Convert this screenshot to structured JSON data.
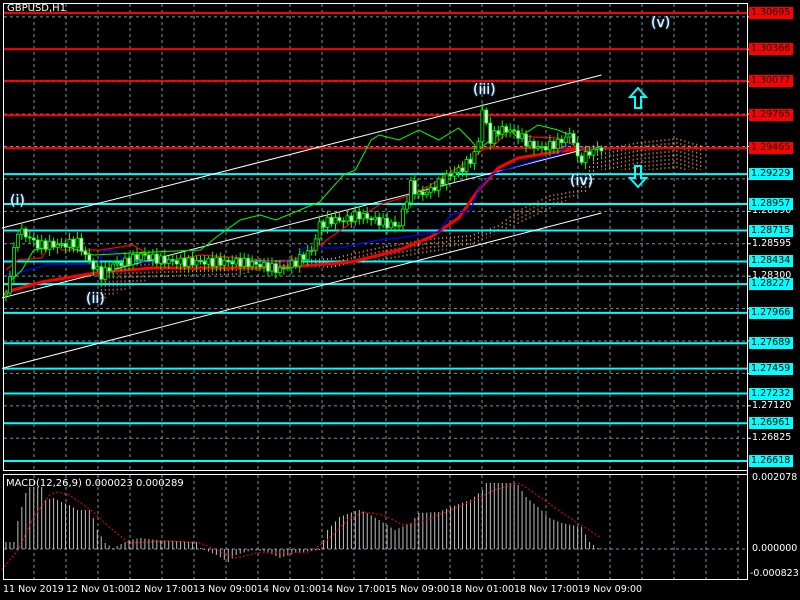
{
  "window": {
    "symbol_title": "GBPUSD,H1"
  },
  "colors": {
    "background": "#000000",
    "resistance": "#ff0000",
    "support": "#00ffff",
    "candle": "#00ff00",
    "tenkan": "#ff0000",
    "kijun": "#0000ff",
    "moving_average": "#ff0000",
    "chikou": "#00ff00",
    "cloud": "#ffa060",
    "channel": "#ffffff",
    "signal": "#ff0000",
    "histogram": "#c0c0c0"
  },
  "chart_data": [
    {
      "type": "line",
      "title": "GBPUSD,H1",
      "x_unit": "bar index (H1)",
      "ylim": [
        1.265,
        1.3082
      ],
      "grid": true,
      "y_ticks_visible": [
        "1.28890",
        "1.28595",
        "1.28300",
        "1.27120",
        "1.26825"
      ],
      "y_grid_step": 0.00295,
      "y_grid_base": 1.26825,
      "x_tick_labels": [
        "11 Nov 2019",
        "12 Nov 01:00",
        "12 Nov 17:00",
        "13 Nov 09:00",
        "14 Nov 01:00",
        "14 Nov 17:00",
        "15 Nov 09:00",
        "18 Nov 01:00",
        "18 Nov 17:00",
        "19 Nov 09:00"
      ],
      "resistance_levels": [
        "1.30695",
        "1.30366",
        "1.30077",
        "1.29765",
        "1.29465"
      ],
      "support_levels": [
        "1.29229",
        "1.28957",
        "1.28715",
        "1.28434",
        "1.28227",
        "1.27966",
        "1.27689",
        "1.27459",
        "1.27232",
        "1.26961",
        "1.26618"
      ],
      "closes": [
        [
          1,
          1.28129
        ],
        [
          4,
          1.2872
        ],
        [
          6,
          1.28675
        ],
        [
          9,
          1.28584
        ],
        [
          11,
          1.28584
        ],
        [
          15,
          1.28584
        ],
        [
          19,
          1.28611
        ],
        [
          22,
          1.28429
        ],
        [
          25,
          1.28311
        ],
        [
          28,
          1.28402
        ],
        [
          31,
          1.28429
        ],
        [
          35,
          1.28493
        ],
        [
          40,
          1.28447
        ],
        [
          45,
          1.28429
        ],
        [
          50,
          1.28429
        ],
        [
          55,
          1.28429
        ],
        [
          60,
          1.28429
        ],
        [
          65,
          1.28402
        ],
        [
          70,
          1.28356
        ],
        [
          74,
          1.28429
        ],
        [
          78,
          1.28538
        ],
        [
          80,
          1.28766
        ],
        [
          83,
          1.28811
        ],
        [
          86,
          1.28811
        ],
        [
          90,
          1.28857
        ],
        [
          94,
          1.28811
        ],
        [
          98,
          1.28766
        ],
        [
          100,
          1.28766
        ],
        [
          103,
          1.2913
        ],
        [
          105,
          1.29039
        ],
        [
          108,
          1.29084
        ],
        [
          111,
          1.29175
        ],
        [
          114,
          1.29248
        ],
        [
          116,
          1.29284
        ],
        [
          119,
          1.29403
        ],
        [
          120,
          1.29539
        ],
        [
          121,
          1.29812
        ],
        [
          123,
          1.29539
        ],
        [
          125,
          1.2963
        ],
        [
          128,
          1.2963
        ],
        [
          130,
          1.29585
        ],
        [
          133,
          1.29494
        ],
        [
          136,
          1.29466
        ],
        [
          140,
          1.29512
        ],
        [
          143,
          1.29585
        ],
        [
          144,
          1.29539
        ],
        [
          145,
          1.29357
        ],
        [
          146,
          1.29375
        ],
        [
          149,
          1.29448
        ],
        [
          151,
          1.29466
        ]
      ],
      "series": [
        {
          "name": "moving_average",
          "points": [
            [
              1,
              1.28156
            ],
            [
              10,
              1.28247
            ],
            [
              25,
              1.28338
            ],
            [
              38,
              1.28374
            ],
            [
              50,
              1.28374
            ],
            [
              63,
              1.28374
            ],
            [
              75,
              1.28392
            ],
            [
              88,
              1.28429
            ],
            [
              100,
              1.28538
            ],
            [
              108,
              1.28656
            ],
            [
              115,
              1.28829
            ],
            [
              120,
              1.29084
            ],
            [
              125,
              1.29284
            ],
            [
              130,
              1.29375
            ],
            [
              138,
              1.29421
            ],
            [
              145,
              1.29457
            ],
            [
              150,
              1.29466
            ]
          ]
        },
        {
          "name": "kijun",
          "points": [
            [
              1,
              1.28311
            ],
            [
              4,
              1.28329
            ],
            [
              11,
              1.28402
            ],
            [
              24,
              1.28411
            ],
            [
              26,
              1.28538
            ],
            [
              29,
              1.2852
            ],
            [
              31,
              1.28429
            ],
            [
              74,
              1.28429
            ],
            [
              76,
              1.28557
            ],
            [
              85,
              1.28557
            ],
            [
              95,
              1.28629
            ],
            [
              100,
              1.28647
            ],
            [
              110,
              1.28702
            ],
            [
              113,
              1.28857
            ],
            [
              118,
              1.28902
            ],
            [
              120,
              1.29084
            ],
            [
              123,
              1.29221
            ],
            [
              128,
              1.29284
            ],
            [
              135,
              1.29357
            ],
            [
              140,
              1.29403
            ],
            [
              144,
              1.29539
            ],
            [
              146,
              1.29448
            ],
            [
              149,
              1.29466
            ]
          ]
        },
        {
          "name": "tenkan",
          "points": [
            [
              1,
              1.28356
            ],
            [
              4,
              1.28447
            ],
            [
              10,
              1.28466
            ],
            [
              13,
              1.28629
            ],
            [
              15,
              1.28538
            ],
            [
              25,
              1.28538
            ],
            [
              33,
              1.28584
            ],
            [
              40,
              1.28429
            ],
            [
              50,
              1.28493
            ],
            [
              60,
              1.28466
            ],
            [
              70,
              1.28429
            ],
            [
              75,
              1.28466
            ],
            [
              80,
              1.28584
            ],
            [
              89,
              1.28811
            ],
            [
              95,
              1.28948
            ],
            [
              103,
              1.29039
            ],
            [
              108,
              1.2913
            ],
            [
              113,
              1.29248
            ],
            [
              118,
              1.29357
            ],
            [
              121,
              1.29448
            ],
            [
              124,
              1.29494
            ],
            [
              128,
              1.2963
            ],
            [
              133,
              1.29567
            ],
            [
              140,
              1.29558
            ],
            [
              144,
              1.29494
            ],
            [
              145,
              1.29448
            ],
            [
              150,
              1.29448
            ]
          ]
        },
        {
          "name": "chikou",
          "points": [
            [
              1,
              1.2822
            ],
            [
              5,
              1.28356
            ],
            [
              8,
              1.28538
            ],
            [
              15,
              1.28584
            ],
            [
              23,
              1.28493
            ],
            [
              38,
              1.2852
            ],
            [
              50,
              1.28538
            ],
            [
              54,
              1.28656
            ],
            [
              60,
              1.28811
            ],
            [
              65,
              1.28857
            ],
            [
              69,
              1.28811
            ],
            [
              75,
              1.28902
            ],
            [
              80,
              1.28975
            ],
            [
              86,
              1.29221
            ],
            [
              89,
              1.29266
            ],
            [
              93,
              1.29539
            ],
            [
              95,
              1.29585
            ],
            [
              100,
              1.29539
            ],
            [
              105,
              1.2963
            ],
            [
              110,
              1.29539
            ],
            [
              115,
              1.29648
            ],
            [
              118,
              1.29539
            ],
            [
              120,
              1.29448
            ],
            [
              123,
              1.29539
            ],
            [
              125,
              1.29585
            ],
            [
              128,
              1.2963
            ],
            [
              130,
              1.29558
            ],
            [
              135,
              1.29676
            ],
            [
              140,
              1.2963
            ],
            [
              143,
              1.29585
            ]
          ]
        }
      ],
      "cloud": {
        "upper": [
          [
            25,
            1.28402
          ],
          [
            50,
            1.28429
          ],
          [
            68,
            1.28447
          ],
          [
            83,
            1.28466
          ],
          [
            95,
            1.28566
          ],
          [
            108,
            1.28647
          ],
          [
            118,
            1.28675
          ],
          [
            125,
            1.28766
          ],
          [
            130,
            1.28902
          ],
          [
            138,
            1.29039
          ],
          [
            145,
            1.29084
          ],
          [
            150,
            1.29448
          ],
          [
            160,
            1.29521
          ],
          [
            170,
            1.29558
          ],
          [
            176,
            1.29494
          ]
        ],
        "lower": [
          [
            25,
            1.28083
          ],
          [
            38,
            1.28284
          ],
          [
            50,
            1.28311
          ],
          [
            60,
            1.28311
          ],
          [
            70,
            1.28402
          ],
          [
            83,
            1.28374
          ],
          [
            93,
            1.28429
          ],
          [
            105,
            1.28493
          ],
          [
            118,
            1.28584
          ],
          [
            130,
            1.28766
          ],
          [
            140,
            1.28948
          ],
          [
            148,
            1.29084
          ],
          [
            150,
            1.29266
          ],
          [
            176,
            1.29266
          ]
        ]
      },
      "channel_lines": [
        {
          "name": "upper",
          "from": [
            0,
            1.28738
          ],
          "to": [
            151,
            1.30131
          ]
        },
        {
          "name": "middle",
          "from": [
            0,
            1.28102
          ],
          "to": [
            148,
            1.29466
          ]
        },
        {
          "name": "lower",
          "from": [
            0,
            1.27461
          ],
          "to": [
            151,
            1.28875
          ]
        }
      ],
      "wave_labels": [
        "(i)",
        "(ii)",
        "(iii)",
        "(iv)",
        "(v)"
      ],
      "arrows": [
        "up-arrow",
        "down-arrow"
      ]
    },
    {
      "type": "bar",
      "title": "MACD(12,26,9) 0.000023 0.000289",
      "ylim": [
        -0.000823,
        0.002078
      ],
      "y_tick_labels": [
        "0.002078",
        "0.000000",
        "-0.000823"
      ],
      "histogram": [
        [
          3,
          0.000208
        ],
        [
          4,
          0.000831
        ],
        [
          5,
          0.001247
        ],
        [
          6,
          0.001662
        ],
        [
          7,
          0.001841
        ],
        [
          10,
          0.001841
        ],
        [
          11,
          0.001455
        ],
        [
          13,
          0.001514
        ],
        [
          15,
          0.001395
        ],
        [
          17,
          0.001306
        ],
        [
          19,
          0.001158
        ],
        [
          22,
          0.001158
        ],
        [
          23,
          0.00092
        ],
        [
          24,
          0.000564
        ],
        [
          26,
          0.000178
        ],
        [
          28,
          3e-05
        ],
        [
          32,
          0.000267
        ],
        [
          35,
          0.000327
        ],
        [
          39,
          0.000267
        ],
        [
          49,
          0.000208
        ],
        [
          50,
          3e-05
        ],
        [
          54,
          -0.000178
        ],
        [
          57,
          -0.000386
        ],
        [
          59,
          -0.000178
        ],
        [
          63,
          -3e-05
        ],
        [
          67,
          -8.9e-05
        ],
        [
          70,
          -0.000267
        ],
        [
          74,
          -0.000119
        ],
        [
          80,
          -3e-05
        ],
        [
          82,
          0.000564
        ],
        [
          85,
          0.00095
        ],
        [
          89,
          0.001128
        ],
        [
          90,
          0.001158
        ],
        [
          92,
          0.001069
        ],
        [
          95,
          0.000861
        ],
        [
          99,
          0.000564
        ],
        [
          103,
          0.000772
        ],
        [
          105,
          0.001069
        ],
        [
          110,
          0.001098
        ],
        [
          113,
          0.001247
        ],
        [
          118,
          0.001455
        ],
        [
          121,
          0.001752
        ],
        [
          122,
          0.001959
        ],
        [
          128,
          0.001959
        ],
        [
          130,
          0.0019
        ],
        [
          132,
          0.001544
        ],
        [
          135,
          0.001247
        ],
        [
          138,
          0.00092
        ],
        [
          141,
          0.000772
        ],
        [
          146,
          0.000653
        ],
        [
          148,
          0.000208
        ],
        [
          150,
          3e-05
        ],
        [
          152,
          0
        ]
      ],
      "signal": [
        [
          0,
          -0.000623
        ],
        [
          4,
          -3e-05
        ],
        [
          8,
          0.00095
        ],
        [
          12,
          0.001603
        ],
        [
          14,
          0.001692
        ],
        [
          17,
          0.001603
        ],
        [
          23,
          0.001098
        ],
        [
          27,
          0.000653
        ],
        [
          32,
          0.000178
        ],
        [
          37,
          0.000208
        ],
        [
          42,
          0.000237
        ],
        [
          50,
          0.000178
        ],
        [
          55,
          -8.9e-05
        ],
        [
          59,
          -0.000267
        ],
        [
          64,
          -0.000119
        ],
        [
          72,
          -8.9e-05
        ],
        [
          77,
          -0.000119
        ],
        [
          82,
          0.000267
        ],
        [
          87,
          0.000861
        ],
        [
          91,
          0.001098
        ],
        [
          96,
          0.001009
        ],
        [
          101,
          0.000712
        ],
        [
          107,
          0.000861
        ],
        [
          113,
          0.001158
        ],
        [
          119,
          0.001455
        ],
        [
          124,
          0.001752
        ],
        [
          130,
          0.001959
        ],
        [
          133,
          0.001752
        ],
        [
          139,
          0.001247
        ],
        [
          145,
          0.000772
        ],
        [
          151,
          0.000327
        ]
      ]
    }
  ]
}
